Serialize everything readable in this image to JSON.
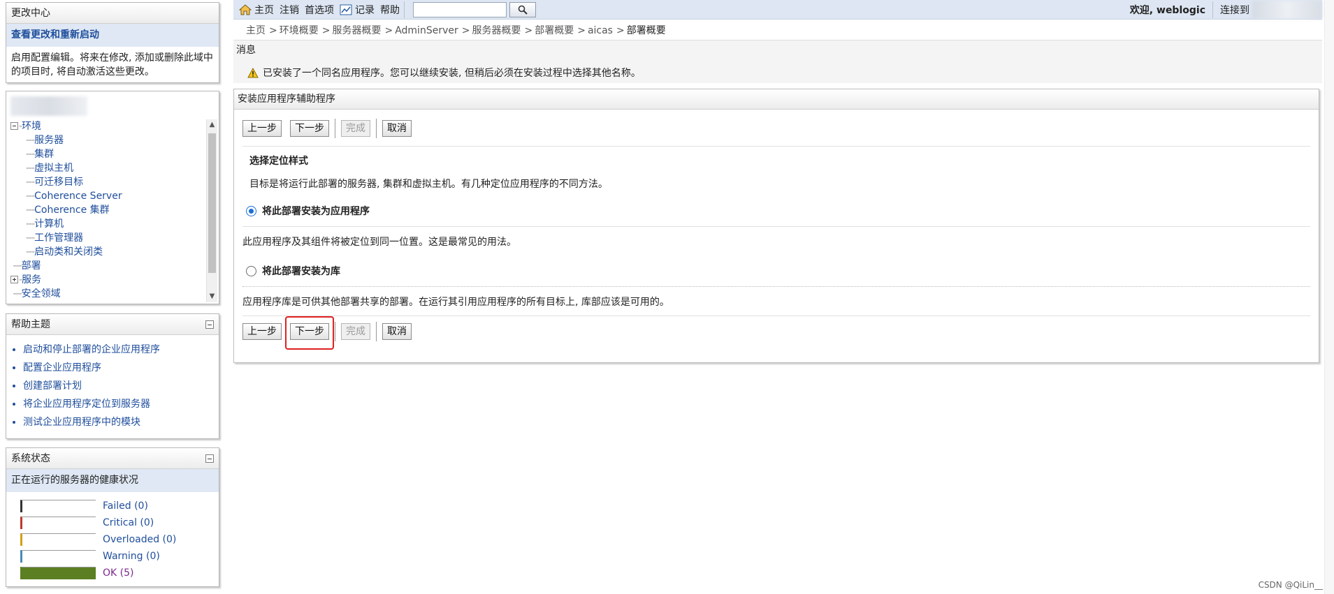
{
  "change_center": {
    "title": "更改中心",
    "link": "查看更改和重新启动",
    "description": "启用配置编辑。将来在修改, 添加或删除此域中的项目时, 将自动激活这些更改。"
  },
  "domain_tree": {
    "root": "环境",
    "children": [
      "服务器",
      "集群",
      "虚拟主机",
      "可迁移目标",
      "Coherence Server",
      "Coherence 集群",
      "计算机",
      "工作管理器",
      "启动类和关闭类"
    ],
    "siblings": [
      "部署",
      "服务",
      "安全领域"
    ]
  },
  "help_topics": {
    "title": "帮助主题",
    "items": [
      "启动和停止部署的企业应用程序",
      "配置企业应用程序",
      "创建部署计划",
      "将企业应用程序定位到服务器",
      "测试企业应用程序中的模块"
    ]
  },
  "system_status": {
    "title": "系统状态",
    "subtitle": "正在运行的服务器的健康状况",
    "rows": [
      {
        "label": "Failed (0)",
        "color": "#333333",
        "fill": 0
      },
      {
        "label": "Critical (0)",
        "color": "#c0392b",
        "fill": 0
      },
      {
        "label": "Overloaded (0)",
        "color": "#d4a017",
        "fill": 0
      },
      {
        "label": "Warning (0)",
        "color": "#4a8ab5",
        "fill": 0
      },
      {
        "label": "OK (5)",
        "color": "#5b7f22",
        "fill": 1.0
      }
    ]
  },
  "toolbar": {
    "home": "主页",
    "logout": "注销",
    "preferences": "首选项",
    "record": "记录",
    "help": "帮助",
    "welcome": "欢迎, weblogic",
    "connect": "连接到"
  },
  "breadcrumb": {
    "items": [
      "主页",
      "环境概要",
      "服务器概要",
      "AdminServer",
      "服务器概要",
      "部署概要",
      "aicas"
    ],
    "current": "部署概要"
  },
  "message": {
    "title": "消息",
    "text": "已安装了一个同名应用程序。您可以继续安装, 但稍后必须在安装过程中选择其他名称。"
  },
  "wizard": {
    "title": "安装应用程序辅助程序",
    "buttons": {
      "back": "上一步",
      "next": "下一步",
      "finish": "完成",
      "cancel": "取消"
    },
    "section_title": "选择定位样式",
    "section_desc": "目标是将运行此部署的服务器, 集群和虚拟主机。有几种定位应用程序的不同方法。",
    "option_app": "将此部署安装为应用程序",
    "option_app_desc": "此应用程序及其组件将被定位到同一位置。这是最常见的用法。",
    "option_lib": "将此部署安装为库",
    "option_lib_desc": "应用程序库是可供其他部署共享的部署。在运行其引用应用程序的所有目标上, 库部应该是可用的。"
  },
  "watermark": "CSDN @QiLin__"
}
